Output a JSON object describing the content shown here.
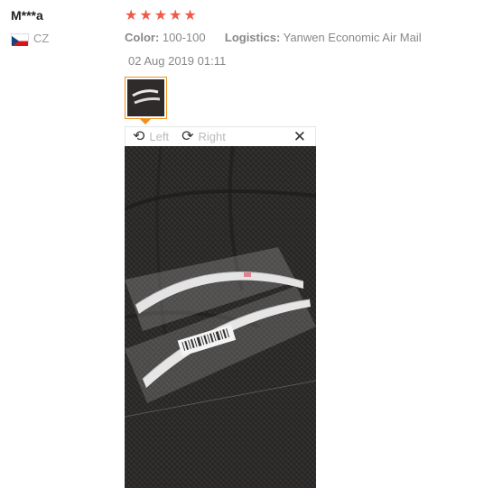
{
  "review": {
    "reviewer": "M***a",
    "country": "CZ",
    "rating": 5,
    "color_label": "Color:",
    "color_value": "100-100",
    "logistics_label": "Logistics:",
    "logistics_value": "Yanwen Economic Air Mail",
    "date": "02 Aug 2019 01:11"
  },
  "viewer": {
    "rotate_left_label": "Left",
    "rotate_right_label": "Right",
    "rotate_left_icon": "rotate-left-icon",
    "rotate_right_icon": "rotate-right-icon",
    "close_icon": "close-icon"
  },
  "colors": {
    "stars": "#f05a4a",
    "thumbnail_border": "#f38f1a",
    "flag_white": "#ffffff",
    "flag_red": "#d7141a",
    "flag_blue": "#11457e"
  }
}
